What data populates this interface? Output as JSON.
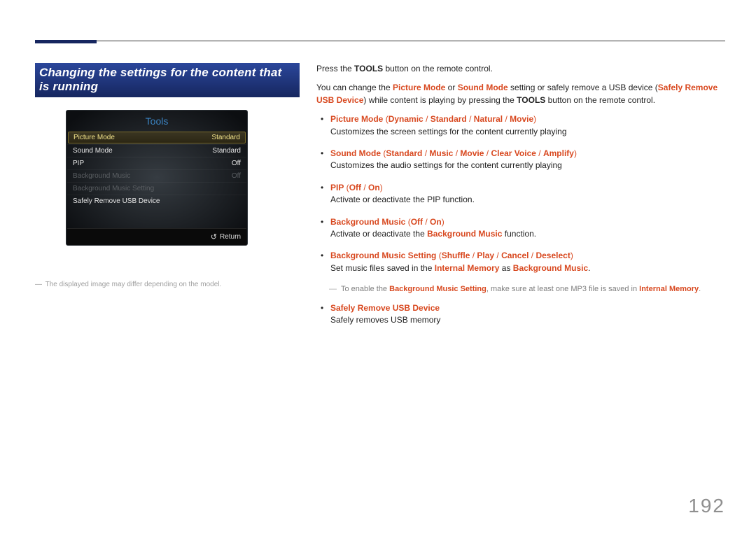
{
  "page_number": "192",
  "heading": "Changing the settings for the content that is running",
  "tools_panel": {
    "title": "Tools",
    "rows": [
      {
        "label": "Picture Mode",
        "value": "Standard",
        "state": "selected"
      },
      {
        "label": "Sound Mode",
        "value": "Standard",
        "state": "normal"
      },
      {
        "label": "PIP",
        "value": "Off",
        "state": "normal"
      },
      {
        "label": "Background Music",
        "value": "Off",
        "state": "disabled"
      },
      {
        "label": "Background Music Setting",
        "value": "",
        "state": "disabled"
      },
      {
        "label": "Safely Remove USB Device",
        "value": "",
        "state": "normal"
      }
    ],
    "return_label": "Return"
  },
  "footnote": "The displayed image may differ depending on the model.",
  "intro1_a": "Press the ",
  "intro1_b": "TOOLS",
  "intro1_c": " button on the remote control.",
  "intro2_a": "You can change the ",
  "intro2_b": "Picture Mode",
  "intro2_c": " or ",
  "intro2_d": "Sound Mode",
  "intro2_e": " setting or safely remove a USB device (",
  "intro2_f": "Safely Remove USB Device",
  "intro2_g": ") while content is playing by pressing the ",
  "intro2_h": "TOOLS",
  "intro2_i": " button on the remote control.",
  "items": {
    "picture_mode": {
      "name": "Picture Mode",
      "opts": [
        "Dynamic",
        "Standard",
        "Natural",
        "Movie"
      ],
      "desc": "Customizes the screen settings for the content currently playing"
    },
    "sound_mode": {
      "name": "Sound Mode",
      "opts": [
        "Standard",
        "Music",
        "Movie",
        "Clear Voice",
        "Amplify"
      ],
      "desc": "Customizes the audio settings for the content currently playing"
    },
    "pip": {
      "name": "PIP",
      "opts": [
        "Off",
        "On"
      ],
      "desc": "Activate or deactivate the PIP function."
    },
    "bg_music": {
      "name": "Background Music",
      "opts": [
        "Off",
        "On"
      ],
      "desc_a": "Activate or deactivate the ",
      "desc_b": "Background Music",
      "desc_c": " function."
    },
    "bg_music_setting": {
      "name": "Background Music Setting",
      "opts": [
        "Shuffle",
        "Play",
        "Cancel",
        "Deselect"
      ],
      "desc_a": "Set music files saved in the ",
      "desc_b": "Internal Memory",
      "desc_c": " as ",
      "desc_d": "Background Music",
      "desc_e": "."
    },
    "safely_remove": {
      "name": "Safely Remove USB Device",
      "desc": "Safely removes USB memory"
    }
  },
  "note_a": "To enable the ",
  "note_b": "Background Music Setting",
  "note_c": ", make sure at least one MP3 file is saved in ",
  "note_d": "Internal Memory",
  "note_e": ".",
  "sep": " / ",
  "open_paren": " (",
  "close_paren": ")"
}
